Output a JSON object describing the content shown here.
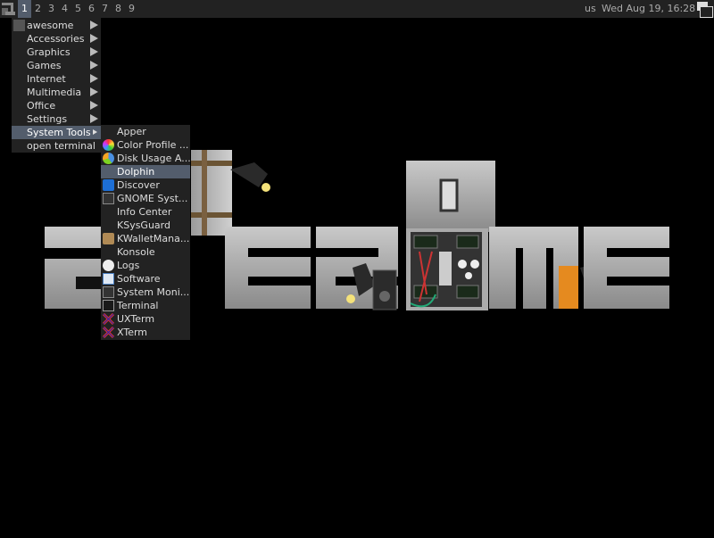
{
  "wibar": {
    "tags": [
      "1",
      "2",
      "3",
      "4",
      "5",
      "6",
      "7",
      "8",
      "9"
    ],
    "active_tag": "1",
    "keyboard_layout": "us",
    "clock": "Wed Aug 19, 16:28"
  },
  "main_menu": {
    "items": [
      {
        "label": "awesome",
        "submenu": true
      },
      {
        "label": "Accessories",
        "submenu": true
      },
      {
        "label": "Graphics",
        "submenu": true
      },
      {
        "label": "Games",
        "submenu": true
      },
      {
        "label": "Internet",
        "submenu": true
      },
      {
        "label": "Multimedia",
        "submenu": true
      },
      {
        "label": "Office",
        "submenu": true
      },
      {
        "label": "Settings",
        "submenu": true
      },
      {
        "label": "System Tools",
        "submenu": true
      },
      {
        "label": "open terminal",
        "submenu": false
      }
    ],
    "selected": "System Tools"
  },
  "system_tools_menu": {
    "items": [
      {
        "label": "Apper",
        "icon": "none"
      },
      {
        "label": "Color Profile ...",
        "icon": "color-profile-icon"
      },
      {
        "label": "Disk Usage A...",
        "icon": "disk-usage-icon"
      },
      {
        "label": "Dolphin",
        "icon": "none"
      },
      {
        "label": "Discover",
        "icon": "discover-icon"
      },
      {
        "label": "GNOME Syst...",
        "icon": "gnome-system-monitor-icon"
      },
      {
        "label": "Info Center",
        "icon": "none"
      },
      {
        "label": "KSysGuard",
        "icon": "none"
      },
      {
        "label": "KWalletMana...",
        "icon": "kwallet-icon"
      },
      {
        "label": "Konsole",
        "icon": "none"
      },
      {
        "label": "Logs",
        "icon": "logs-icon"
      },
      {
        "label": "Software",
        "icon": "software-icon"
      },
      {
        "label": "System Moni...",
        "icon": "system-monitor-icon"
      },
      {
        "label": "Terminal",
        "icon": "terminal-icon"
      },
      {
        "label": "UXTerm",
        "icon": "uxterm-icon"
      },
      {
        "label": "XTerm",
        "icon": "xterm-icon"
      }
    ],
    "selected": "Dolphin"
  },
  "colors": {
    "wibar_bg": "#222222",
    "selection_bg": "#535d6c",
    "logo_grey": "#a8a8a8",
    "accent_orange": "#e58a1f"
  }
}
